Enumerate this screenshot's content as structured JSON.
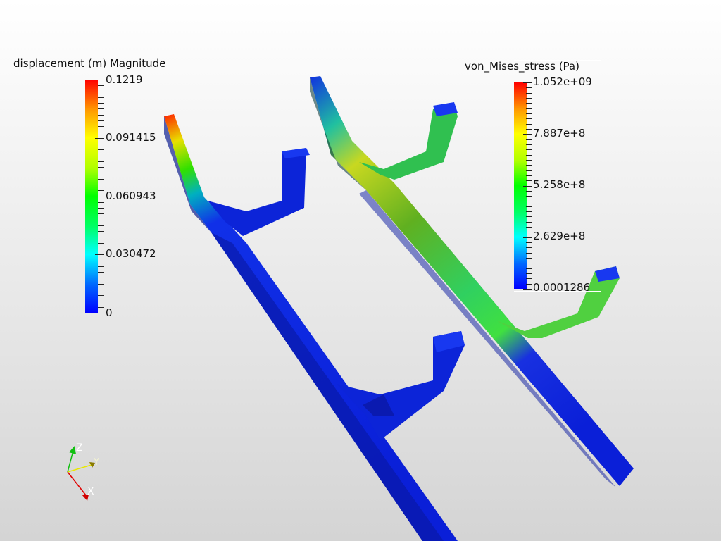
{
  "legend_displacement": {
    "title": "displacement (m) Magnitude",
    "labels": [
      "0.1219",
      "0.091415",
      "0.060943",
      "0.030472",
      "0"
    ]
  },
  "legend_stress": {
    "title": "von_Mises_stress (Pa)",
    "labels": [
      "1.052e+09",
      "7.887e+8",
      "5.258e+8",
      "2.629e+8",
      "0.0001286"
    ]
  },
  "axes": {
    "x": "X",
    "y": "Y",
    "z": "Z"
  },
  "colors": {
    "x_axis": "#e00000",
    "y_axis": "#e8e800",
    "z_axis": "#10c010",
    "mesh_low": "#0a1fd8"
  }
}
